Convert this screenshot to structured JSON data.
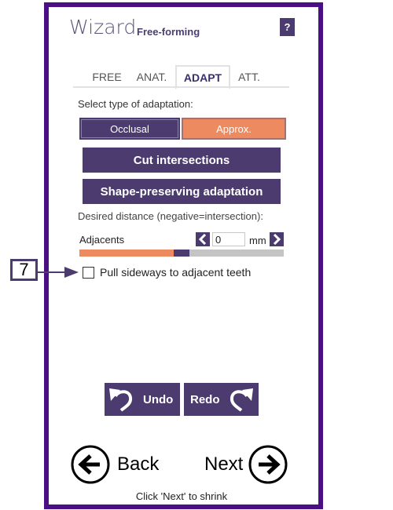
{
  "header": {
    "title": "Wizard",
    "subtitle": "Free-forming",
    "help_label": "?"
  },
  "tabs": [
    {
      "label": "FREE",
      "active": false
    },
    {
      "label": "ANAT.",
      "active": false
    },
    {
      "label": "ADAPT",
      "active": true
    },
    {
      "label": "ATT.",
      "active": false
    }
  ],
  "adaptation": {
    "select_label": "Select type of adaptation:",
    "options": [
      {
        "label": "Occlusal",
        "selected": false
      },
      {
        "label": "Approx.",
        "selected": true
      }
    ],
    "cut_label": "Cut intersections",
    "shape_label": "Shape-preserving adaptation"
  },
  "distance": {
    "label": "Desired distance (negative=intersection):",
    "adjacents_label": "Adjacents",
    "value": "0",
    "unit": "mm",
    "slider_fraction": 0.5
  },
  "pull_sideways": {
    "label": "Pull sideways to adjacent teeth",
    "checked": false
  },
  "callout": {
    "number": "7"
  },
  "history": {
    "undo_label": "Undo",
    "redo_label": "Redo"
  },
  "navigation": {
    "back_label": "Back",
    "next_label": "Next",
    "hint": "Click 'Next' to shrink"
  },
  "colors": {
    "frame": "#4b0f85",
    "primary": "#4b3b6e",
    "accent": "#ee8a5f",
    "track": "#c4c4c4"
  }
}
